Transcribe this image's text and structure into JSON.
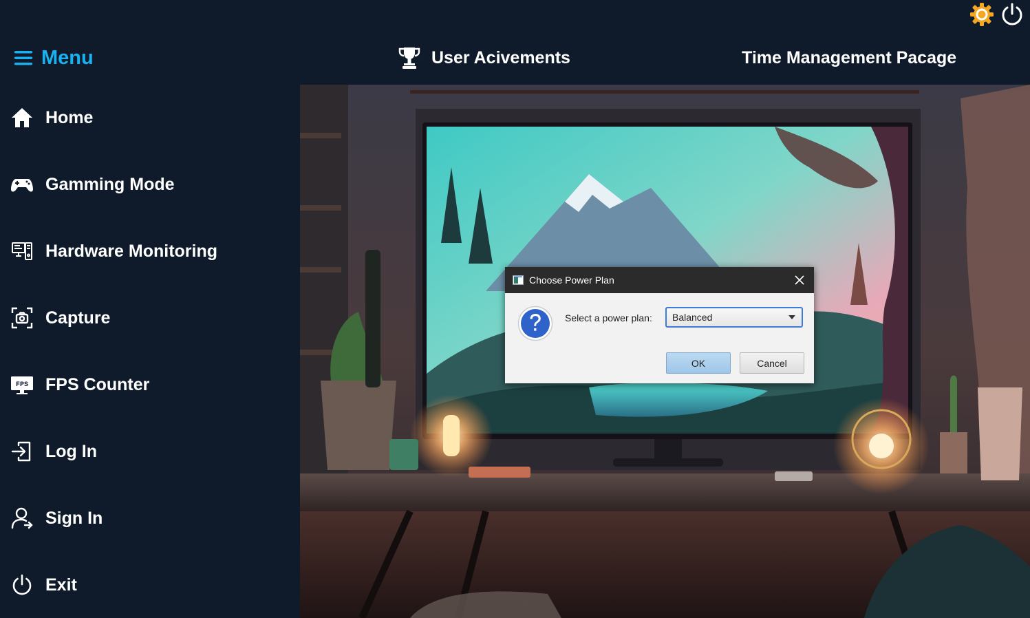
{
  "header": {
    "menu_label": "Menu",
    "achievements_label": "User Acivements",
    "time_label": "Time Management Pacage"
  },
  "sidebar": {
    "items": [
      {
        "label": "Home",
        "icon": "home-icon"
      },
      {
        "label": "Gamming Mode",
        "icon": "gamepad-icon"
      },
      {
        "label": "Hardware Monitoring",
        "icon": "hardware-icon"
      },
      {
        "label": "Capture",
        "icon": "camera-capture-icon"
      },
      {
        "label": "FPS Counter",
        "icon": "fps-monitor-icon"
      },
      {
        "label": "Log In",
        "icon": "login-icon"
      },
      {
        "label": "Sign In",
        "icon": "user-icon"
      },
      {
        "label": "Exit",
        "icon": "power-icon"
      }
    ]
  },
  "dialog": {
    "title": "Choose Power Plan",
    "prompt": "Select a power plan:",
    "selected_plan": "Balanced",
    "ok_label": "OK",
    "cancel_label": "Cancel"
  },
  "icons": {
    "fps_badge": "FPS"
  },
  "colors": {
    "background": "#0f1b2b",
    "accent": "#19b2f0",
    "gear": "#f5a623",
    "dialog_titlebar": "#2b2b2b",
    "combo_border": "#3d7bd9"
  }
}
